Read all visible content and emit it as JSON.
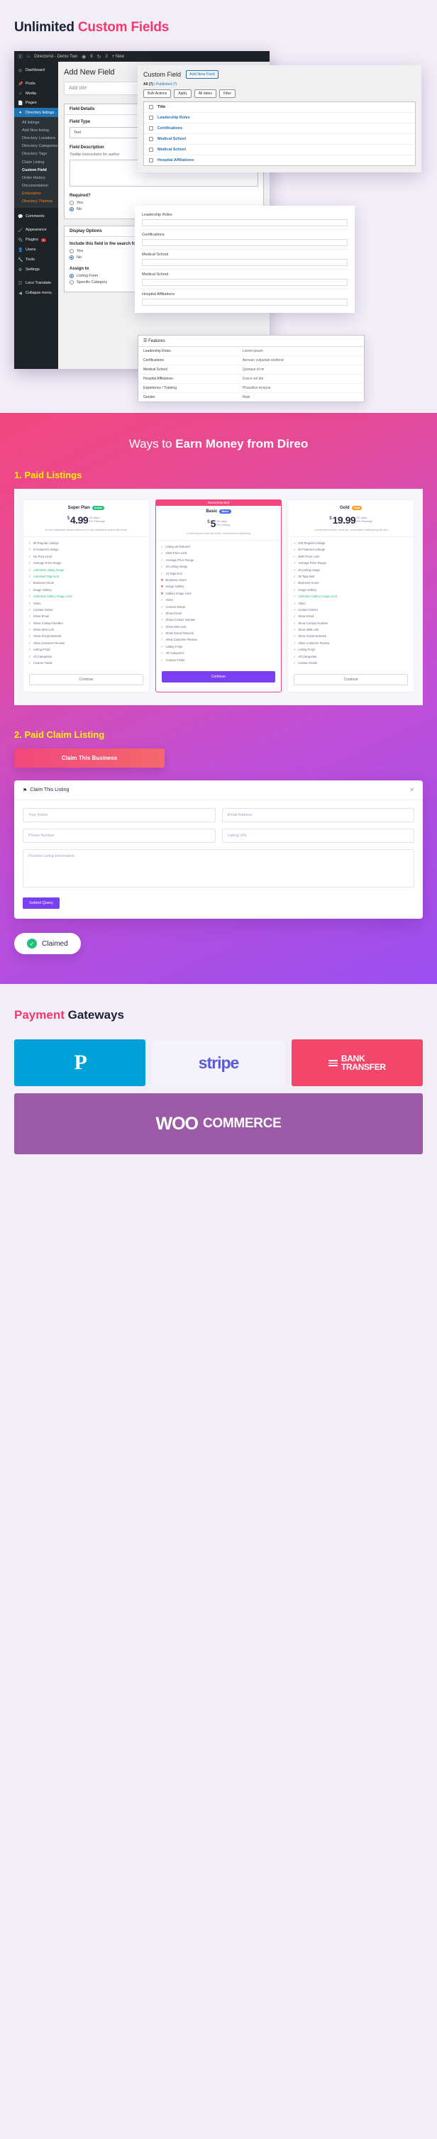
{
  "section1": {
    "title_plain": "Unlimited ",
    "title_accent": "Custom Fields",
    "adminbar": {
      "wp_icon": "wordpress-icon",
      "home_icon": "home-icon",
      "site_name": "Directorist - Demo Two",
      "comments_icon": "comment-icon",
      "comments_count": "9",
      "updates_icon": "update-icon",
      "updates_count": "2",
      "new_label": "+ New"
    },
    "menu": [
      {
        "label": "Dashboard",
        "icon": "dashboard-icon"
      },
      {
        "label": "Posts",
        "icon": "pin-icon"
      },
      {
        "label": "Media",
        "icon": "media-icon"
      },
      {
        "label": "Pages",
        "icon": "page-icon"
      },
      {
        "label": "Directory listings",
        "icon": "directory-icon",
        "current": true
      }
    ],
    "submenu": [
      {
        "label": "All listings"
      },
      {
        "label": "Add New listing"
      },
      {
        "label": "Directory Locations"
      },
      {
        "label": "Directory Categories"
      },
      {
        "label": "Directory Tags"
      },
      {
        "label": "Claim Listing"
      },
      {
        "label": "Custom Field",
        "current": true
      },
      {
        "label": "Order History"
      },
      {
        "label": "Documentation"
      },
      {
        "label": "Extensions",
        "highlight": true
      },
      {
        "label": "Directory Themes",
        "highlight": true
      }
    ],
    "menu2": [
      {
        "label": "Comments",
        "icon": "comment-icon"
      },
      {
        "label": "Appearance",
        "icon": "brush-icon"
      },
      {
        "label": "Plugins",
        "icon": "plug-icon",
        "badge": "1"
      },
      {
        "label": "Users",
        "icon": "users-icon"
      },
      {
        "label": "Tools",
        "icon": "tools-icon"
      },
      {
        "label": "Settings",
        "icon": "gear-icon"
      },
      {
        "label": "Loco Translate",
        "icon": "translate-icon"
      },
      {
        "label": "Collapse menu",
        "icon": "collapse-icon"
      }
    ],
    "editor": {
      "page_title": "Add New Field",
      "title_placeholder": "Add title",
      "field_details_header": "Field Details",
      "field_type_label": "Field Type",
      "field_type_value": "Text",
      "field_description_label": "Field Description",
      "field_description_hint": "Tooltip instructions for author",
      "required_label": "Required?",
      "required_yes": "Yes",
      "required_no": "No",
      "display_options_header": "Display Options",
      "search_form_label": "Include this field in the search form?",
      "search_yes": "Yes",
      "search_no": "No",
      "assign_to_label": "Assign to",
      "assign_listing_form": "Listing Form",
      "assign_specific_category": "Specific Category"
    },
    "custom_field_panel": {
      "title": "Custom Field",
      "add_new_button": "Add New Field",
      "filter_all": "All (7)",
      "filter_published": "Published (7)",
      "bulk_actions": "Bulk Actions",
      "apply": "Apply",
      "all_dates": "All dates",
      "filter_btn": "Filter",
      "col_title": "Title",
      "rows": [
        {
          "name": "Leadership Roles"
        },
        {
          "name": "Certifications"
        },
        {
          "name": "Medical School"
        },
        {
          "name": "Medical School"
        },
        {
          "name": "Hospital Affiliations"
        }
      ]
    },
    "fields_preview": [
      {
        "label": "Leadership Roles"
      },
      {
        "label": "Certifications"
      },
      {
        "label": "Medical School"
      },
      {
        "label": "Medical School"
      },
      {
        "label": "Hospital Affiliations"
      }
    ],
    "features_box": {
      "header": "Features",
      "rows": [
        {
          "name": "Leadership Roles",
          "value": "Lorem ipsum"
        },
        {
          "name": "Certifications",
          "value": "Aenean vulputate eleifend"
        },
        {
          "name": "Medical School",
          "value": "Quisque id mi"
        },
        {
          "name": "Hospital Affiliations",
          "value": "Fusce vel dui"
        },
        {
          "name": "Experience / Training",
          "value": "Phasellus tempus"
        },
        {
          "name": "Gender",
          "value": "Male"
        }
      ]
    }
  },
  "section2": {
    "heading_plain": "Ways to ",
    "heading_bold": "Earn Money from Direo",
    "sub1": "1. Paid Listings",
    "sub2": "2. Paid Claim Listing",
    "plans": [
      {
        "name": "Super Plan",
        "pill": "Active",
        "pill_color": "#27c07a",
        "currency": "$",
        "amount": "4.99",
        "per1": "/30 days",
        "per2": "Per Package",
        "desc": "In hac habitasse platea dictumst in hac habitasse platea dictumst",
        "features": [
          {
            "text": "99 Regular Listings",
            "ok": true
          },
          {
            "text": "5 Featured Listings",
            "ok": true
          },
          {
            "text": "No Price Limit",
            "ok": true
          },
          {
            "text": "Average Price Range",
            "ok": true
          },
          {
            "text": "Unlimited Listing Image",
            "ok": true,
            "hl": "Unlimited"
          },
          {
            "text": "Unlimited Tags limit",
            "ok": true,
            "hl": "Unlimited"
          },
          {
            "text": "Business Hours",
            "ok": true
          },
          {
            "text": "Image Gallery",
            "ok": true
          },
          {
            "text": "Unlimited Gallery Image Limit",
            "ok": true,
            "hl": "Unlimited"
          },
          {
            "text": "Video",
            "ok": true
          },
          {
            "text": "Contact Owner",
            "ok": true
          },
          {
            "text": "Show Email",
            "ok": true
          },
          {
            "text": "Show Contact Number",
            "ok": true
          },
          {
            "text": "Show Web Link",
            "ok": true
          },
          {
            "text": "Show Social Network",
            "ok": true
          },
          {
            "text": "Allow Customer Review",
            "ok": true
          },
          {
            "text": "Listing FAQs",
            "ok": true
          },
          {
            "text": "All Categories",
            "ok": true
          },
          {
            "text": "Custom Fields",
            "ok": true
          }
        ],
        "cta": "Continue",
        "cta_style": "outline",
        "ribbon": null
      },
      {
        "name": "Basic",
        "pill": "Basic",
        "pill_color": "#4a6cf7",
        "currency": "$",
        "amount": "5",
        "per1": "/30 days",
        "per2": "Per Listing",
        "desc": "Lorem ipsum dolor sit amet, consectetur adipiscing",
        "features": [
          {
            "text": "Listing as featured",
            "ok": true
          },
          {
            "text": "2000 Price Limit",
            "ok": true
          },
          {
            "text": "Average Price Range",
            "ok": true
          },
          {
            "text": "10 Listing Image",
            "ok": true
          },
          {
            "text": "10 Tags limit",
            "ok": true
          },
          {
            "text": "Business Hours",
            "ok": false
          },
          {
            "text": "Image Gallery",
            "ok": false
          },
          {
            "text": "Gallery Image Limit",
            "ok": false
          },
          {
            "text": "Video",
            "ok": true
          },
          {
            "text": "Contact Owner",
            "ok": true
          },
          {
            "text": "Show Email",
            "ok": true
          },
          {
            "text": "Show Contact Number",
            "ok": true
          },
          {
            "text": "Show Web Link",
            "ok": true
          },
          {
            "text": "Show Social Network",
            "ok": true
          },
          {
            "text": "Allow Customer Review",
            "ok": true
          },
          {
            "text": "Listing FAQs",
            "ok": true
          },
          {
            "text": "All Categories",
            "ok": true
          },
          {
            "text": "Custom Fields",
            "ok": true
          }
        ],
        "cta": "Continue",
        "cta_style": "solid",
        "ribbon": "Recommended"
      },
      {
        "name": "Gold",
        "pill": "Gold",
        "pill_color": "#f5a623",
        "currency": "$",
        "amount": "19.99",
        "per1": "/30 days",
        "per2": "Per Package",
        "desc": "Lorem ipsum dolor sit amet, consectetur adipiscing elit sed",
        "features": [
          {
            "text": "200 Regular Listings",
            "ok": true
          },
          {
            "text": "50 Featured Listings",
            "ok": true
          },
          {
            "text": "5000 Price Limit",
            "ok": true
          },
          {
            "text": "Average Price Range",
            "ok": true
          },
          {
            "text": "20 Listing Image",
            "ok": true
          },
          {
            "text": "25 Tags limit",
            "ok": true
          },
          {
            "text": "Business Hours",
            "ok": true
          },
          {
            "text": "Image Gallery",
            "ok": true
          },
          {
            "text": "Unlimited Gallery Image Limit",
            "ok": true,
            "hl": "Unlimited"
          },
          {
            "text": "Video",
            "ok": true
          },
          {
            "text": "Contact Owner",
            "ok": true
          },
          {
            "text": "Show Email",
            "ok": true
          },
          {
            "text": "Show Contact Number",
            "ok": true
          },
          {
            "text": "Show Web Link",
            "ok": true
          },
          {
            "text": "Show Social Network",
            "ok": true
          },
          {
            "text": "Allow Customer Review",
            "ok": true
          },
          {
            "text": "Listing FAQs",
            "ok": true
          },
          {
            "text": "All Categories",
            "ok": true
          },
          {
            "text": "Custom Fields",
            "ok": true
          }
        ],
        "cta": "Continue",
        "cta_style": "outline",
        "ribbon": null
      }
    ],
    "claim_button": "Claim This Business",
    "claim_form": {
      "title": "Claim This Listing",
      "close_icon": "close-icon",
      "name_placeholder": "Your Name",
      "email_placeholder": "Email Address",
      "phone_placeholder": "Phone Number",
      "url_placeholder": "Listing URL",
      "info_placeholder": "Provide Listing Information",
      "submit": "Submit Query"
    },
    "claimed_badge": {
      "icon": "check-circle-icon",
      "label": "Claimed"
    }
  },
  "section3": {
    "heading_accent": "Payment ",
    "heading_plain": "Gateways",
    "gateways": [
      {
        "name": "PayPal",
        "logo": "paypal-logo",
        "text": "P"
      },
      {
        "name": "Stripe",
        "logo": "stripe-logo",
        "text": "stripe"
      },
      {
        "name": "Bank Transfer",
        "logo": "bank-transfer-logo",
        "line1": "BANK",
        "line2": "TRANSFER"
      },
      {
        "name": "WooCommerce",
        "logo": "woocommerce-logo",
        "text_a": "WOO",
        "text_b": "COMMERCE"
      }
    ]
  }
}
